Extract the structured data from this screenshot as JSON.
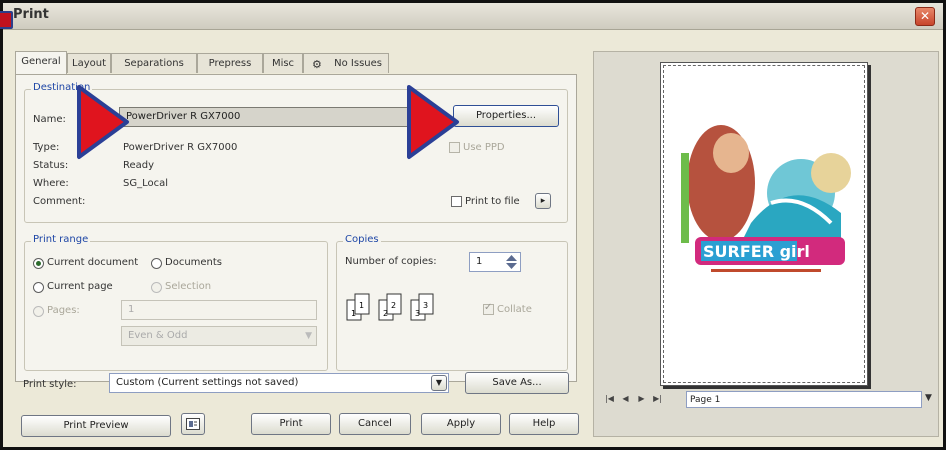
{
  "window": {
    "title": "Print",
    "close_label": "✕"
  },
  "tabs": [
    {
      "label": "General"
    },
    {
      "label": "Layout"
    },
    {
      "label": "Separations"
    },
    {
      "label": "Prepress"
    },
    {
      "label": "Misc"
    },
    {
      "label": "No Issues"
    }
  ],
  "destination": {
    "group_title": "Destination",
    "name_label": "Name:",
    "name_value": "PowerDriver R GX7000",
    "properties_button": "Properties...",
    "type_label": "Type:",
    "type_value": "PowerDriver R GX7000",
    "status_label": "Status:",
    "status_value": "Ready",
    "where_label": "Where:",
    "where_value": "SG_Local",
    "comment_label": "Comment:",
    "use_ppd_label": "Use PPD",
    "print_to_file_label": "Print to file",
    "print_to_file_arrow": "▸"
  },
  "print_range": {
    "group_title": "Print range",
    "current_document": "Current document",
    "documents": "Documents",
    "current_page": "Current page",
    "selection": "Selection",
    "pages_label": "Pages:",
    "pages_value": "1",
    "even_odd_value": "Even & Odd"
  },
  "copies": {
    "group_title": "Copies",
    "number_label": "Number of copies:",
    "number_value": "1",
    "collate_label": "Collate"
  },
  "print_style": {
    "label": "Print style:",
    "value": "Custom (Current settings not saved)",
    "save_as_button": "Save As..."
  },
  "bottom_buttons": {
    "print_preview": "Print Preview",
    "print": "Print",
    "cancel": "Cancel",
    "apply": "Apply",
    "help": "Help"
  },
  "preview": {
    "page_label": "Page 1",
    "artwork_text": "SURFER girl"
  },
  "colors": {
    "arrow_red": "#e0141e",
    "arrow_outline": "#2b3f96",
    "group_title": "#1e46a6"
  }
}
